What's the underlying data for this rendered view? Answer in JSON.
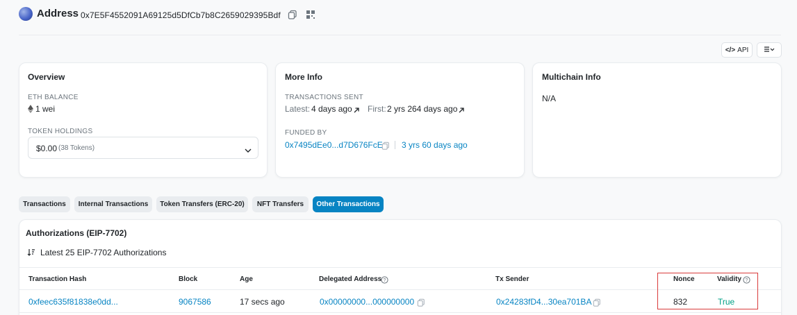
{
  "header": {
    "title": "Address",
    "address": "0x7E5F4552091A69125d5DfCb7b8C2659029395Bdf",
    "copy_icon": "copy-icon",
    "qr_icon": "qr-code-icon"
  },
  "toolbar": {
    "api_label": "API",
    "api_icon": "code-icon",
    "menu_icon": "list-filter-icon"
  },
  "overview": {
    "title": "Overview",
    "eth_balance_label": "ETH BALANCE",
    "eth_balance_value": "1 wei",
    "token_holdings_label": "TOKEN HOLDINGS",
    "token_value": "$0.00",
    "token_count": "(38 Tokens)"
  },
  "more_info": {
    "title": "More Info",
    "tx_sent_label": "TRANSACTIONS SENT",
    "latest_label": "Latest:",
    "latest_value": "4 days ago",
    "first_label": "First:",
    "first_value": "2 yrs 264 days ago",
    "funded_by_label": "FUNDED BY",
    "funded_by_address": "0x7495dEe0...d7D676FcE",
    "funded_by_age": "3 yrs 60 days ago"
  },
  "multichain": {
    "title": "Multichain Info",
    "value": "N/A"
  },
  "tabs": [
    {
      "label": "Transactions",
      "active": false
    },
    {
      "label": "Internal Transactions",
      "active": false
    },
    {
      "label": "Token Transfers (ERC-20)",
      "active": false
    },
    {
      "label": "NFT Transfers",
      "active": false
    },
    {
      "label": "Other Transactions",
      "active": true
    }
  ],
  "authorizations": {
    "title": "Authorizations (EIP-7702)",
    "subtitle": "Latest 25 EIP-7702 Authorizations",
    "columns": [
      "Transaction Hash",
      "Block",
      "Age",
      "Delegated Address",
      "Tx Sender",
      "Nonce",
      "Validity"
    ],
    "rows": [
      {
        "tx_hash": "0xfeec635f81838e0dd...",
        "block": "9067586",
        "age": "17 secs ago",
        "delegated_address": "0x00000000...000000000",
        "tx_sender": "0x24283fD4...30ea701BA",
        "nonce": "832",
        "validity": "True"
      }
    ]
  },
  "colors": {
    "link": "#0784c3",
    "highlight_border": "#d93a3a",
    "active_tab": "#0784c3"
  }
}
